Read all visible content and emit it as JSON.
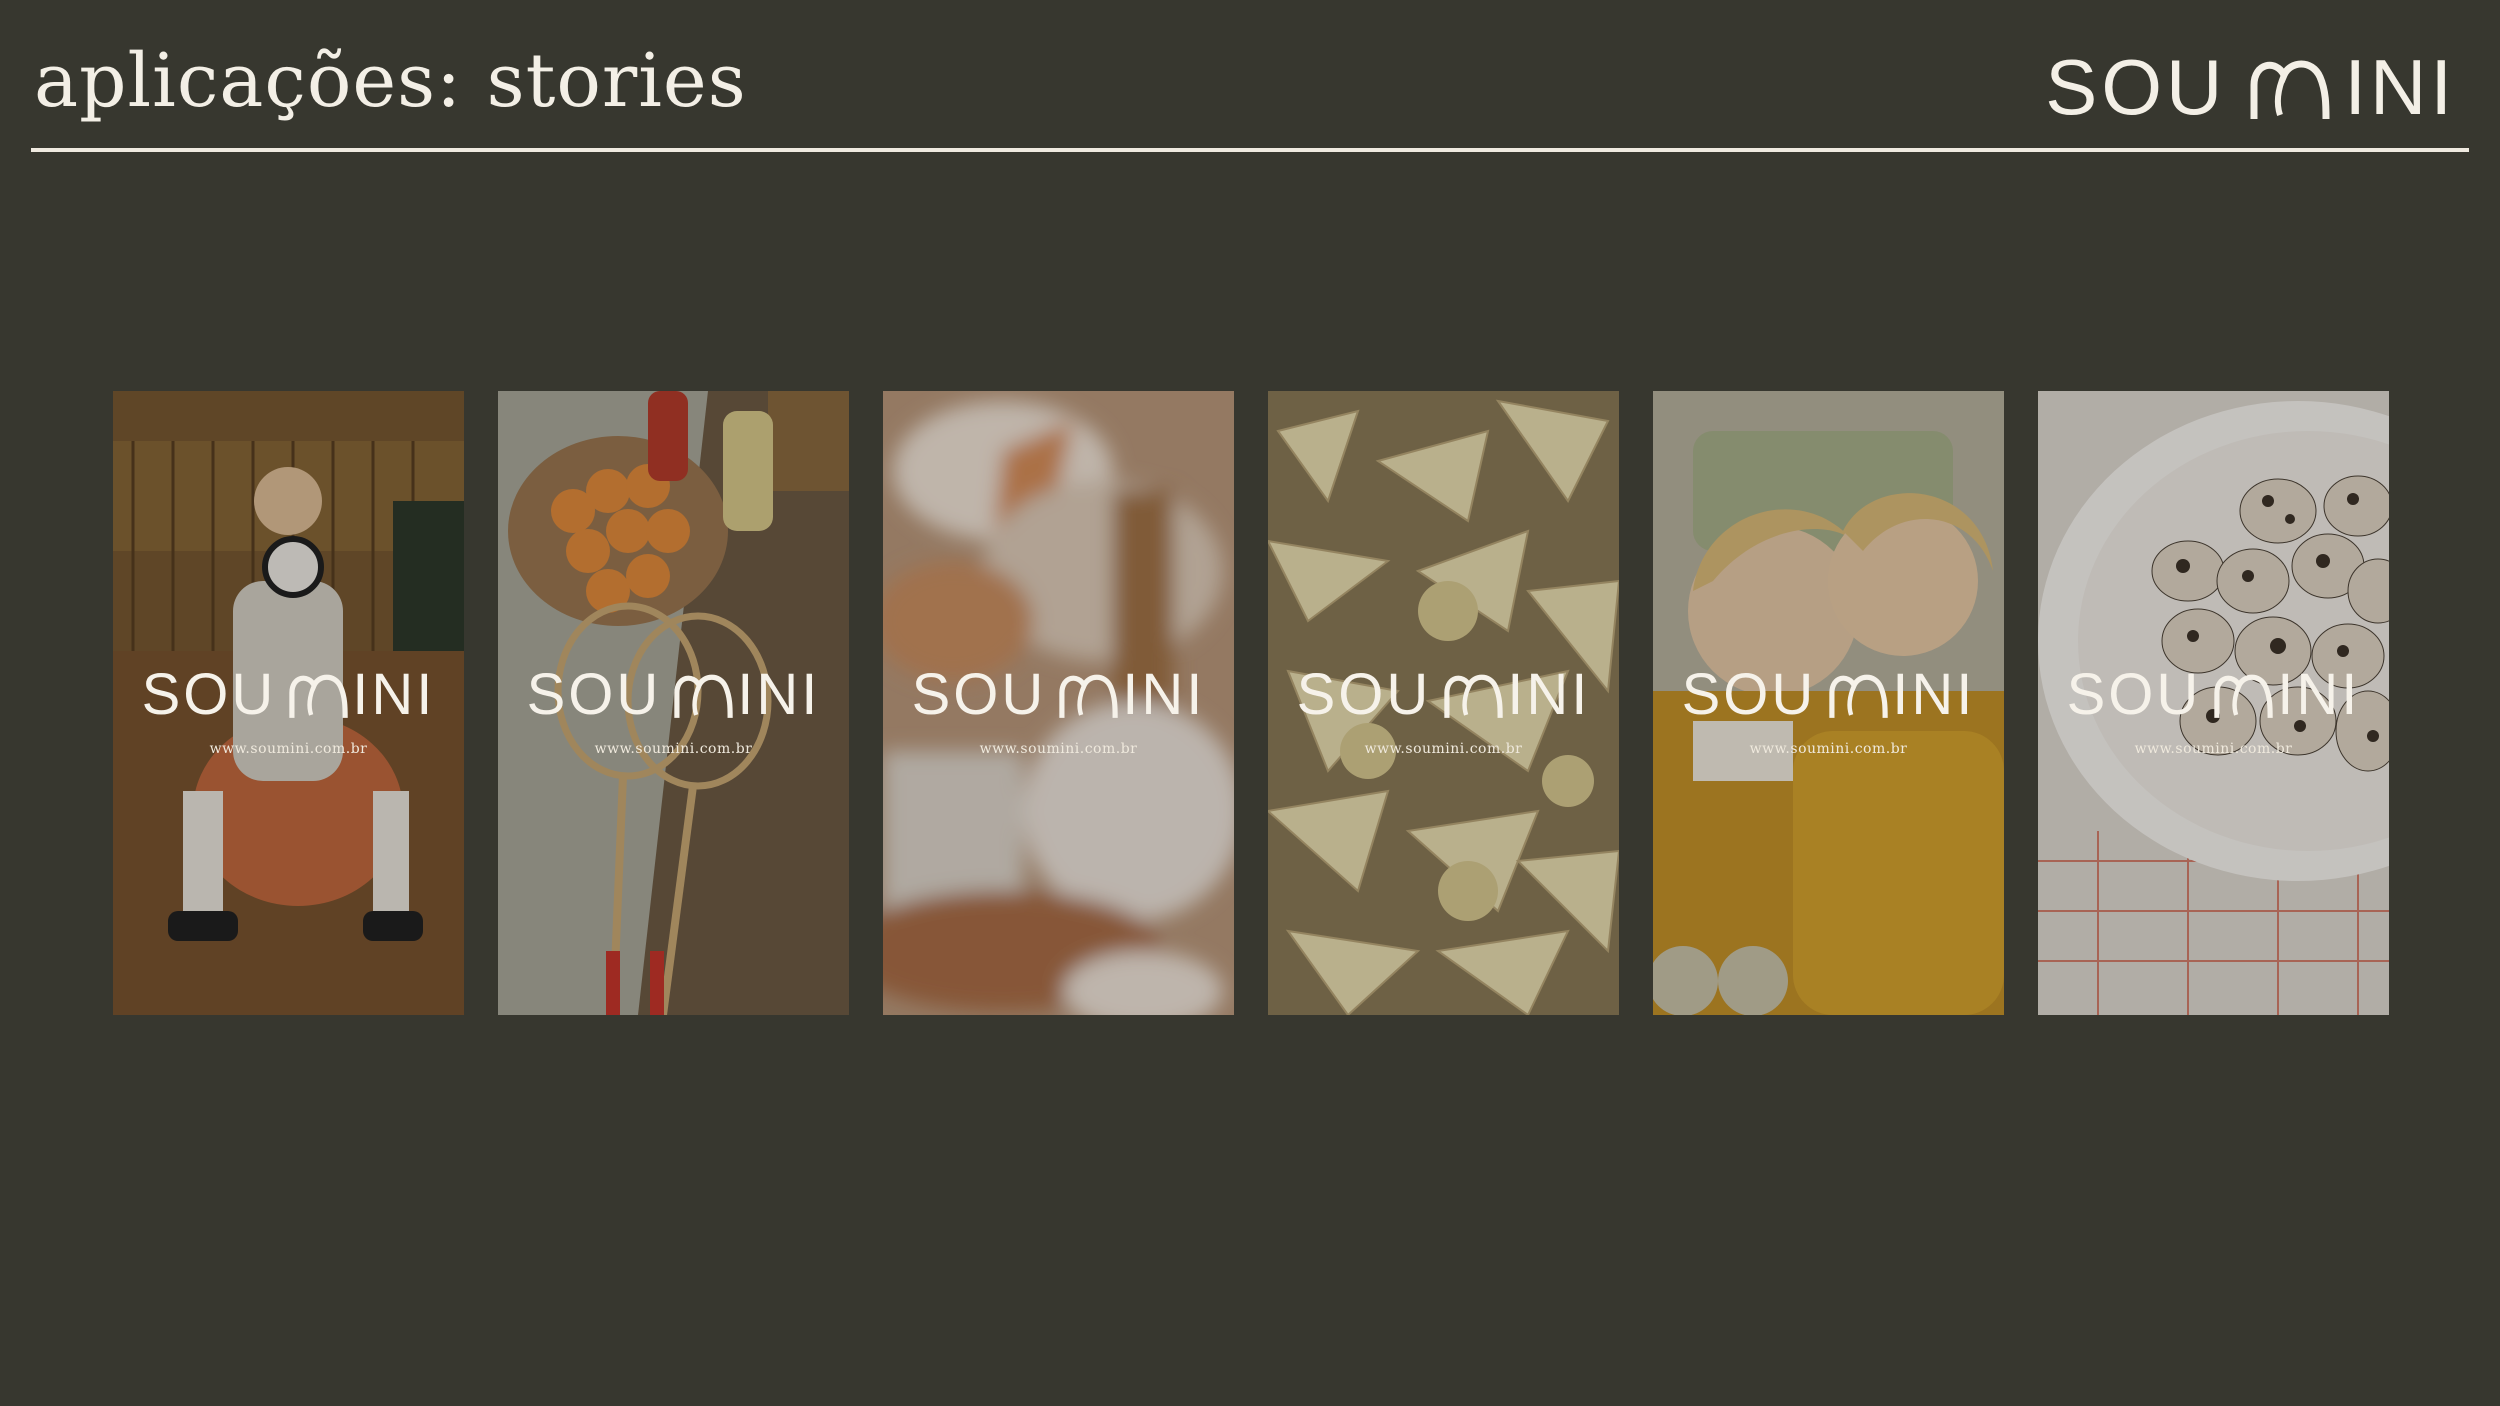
{
  "header": {
    "title": "aplicações: stories",
    "brand": {
      "sou": "SOU",
      "ini": "INI"
    }
  },
  "colors": {
    "background": "#37372f",
    "text": "#f3efe6",
    "rule": "#efeae0"
  },
  "stories": [
    {
      "logo_sou": "SOU",
      "logo_ini": "INI",
      "url": "www.soumini.com.br"
    },
    {
      "logo_sou": "SOU",
      "logo_ini": "INI",
      "url": "www.soumini.com.br"
    },
    {
      "logo_sou": "SOU",
      "logo_ini": "INI",
      "url": "www.soumini.com.br"
    },
    {
      "logo_sou": "SOU",
      "logo_ini": "INI",
      "url": "www.soumini.com.br"
    },
    {
      "logo_sou": "SOU",
      "logo_ini": "INI",
      "url": "www.soumini.com.br"
    },
    {
      "logo_sou": "SOU",
      "logo_ini": "INI",
      "url": "www.soumini.com.br"
    }
  ]
}
